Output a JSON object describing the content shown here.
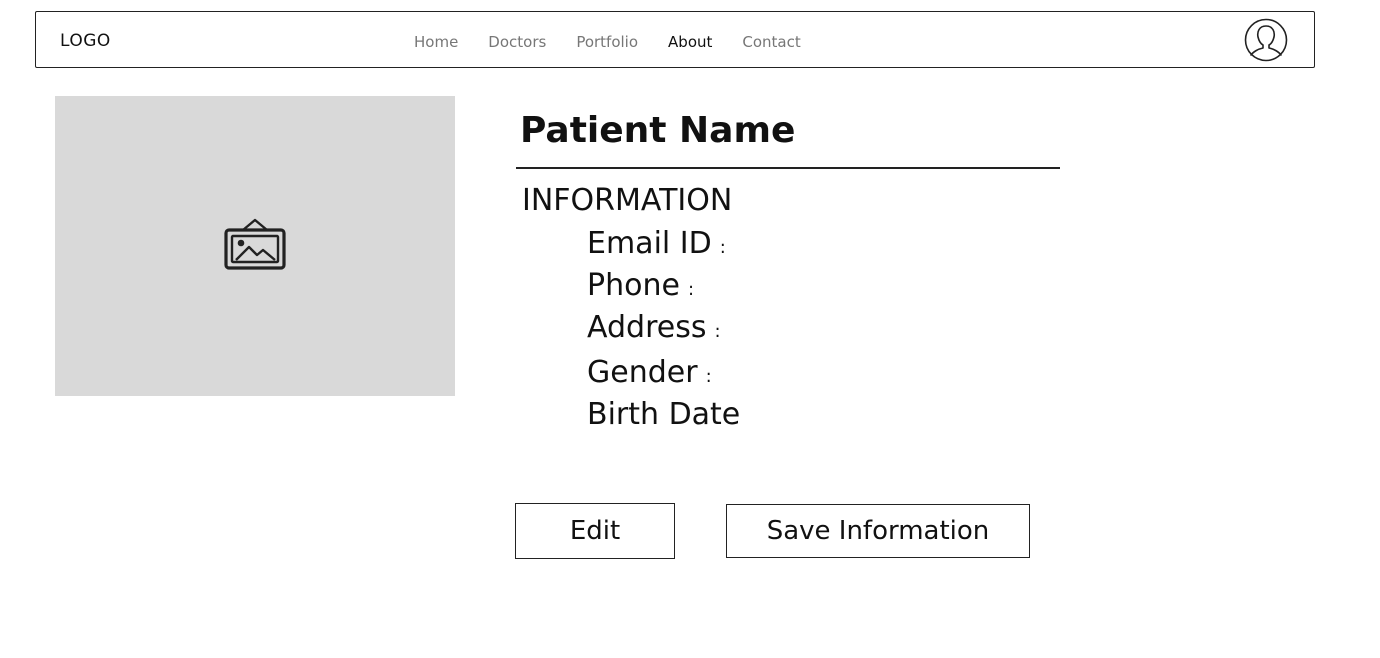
{
  "navbar": {
    "logo": "LOGO",
    "links": [
      {
        "label": "Home",
        "active": false
      },
      {
        "label": "Doctors",
        "active": false
      },
      {
        "label": "Portfolio",
        "active": false
      },
      {
        "label": "About",
        "active": true
      },
      {
        "label": "Contact",
        "active": false
      }
    ],
    "avatar_icon": "user-avatar-icon"
  },
  "profile": {
    "image_icon": "image-placeholder-icon",
    "image_bg_color": "#d9d9d9"
  },
  "patient": {
    "name": "Patient Name",
    "section_heading": "INFORMATION",
    "fields": [
      {
        "label": "Email ID",
        "colon": ":"
      },
      {
        "label": "Phone",
        "colon": ":"
      },
      {
        "label": "Address",
        "colon": ":"
      },
      {
        "label": "Gender",
        "colon": ":"
      },
      {
        "label": "Birth Date",
        "colon": ""
      }
    ]
  },
  "actions": {
    "edit_label": "Edit",
    "save_label": "Save Information"
  }
}
